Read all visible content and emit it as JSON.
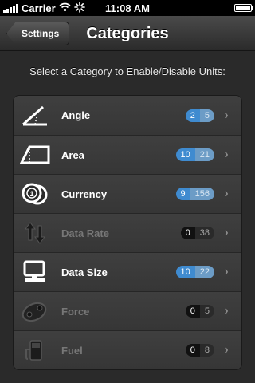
{
  "status_bar": {
    "carrier": "Carrier",
    "time": "11:08 AM"
  },
  "nav": {
    "back_label": "Settings",
    "title": "Categories"
  },
  "instruction": "Select a Category to Enable/Disable Units:",
  "categories": [
    {
      "label": "Angle",
      "enabled": "2",
      "total": "5",
      "state": "on"
    },
    {
      "label": "Area",
      "enabled": "10",
      "total": "21",
      "state": "on"
    },
    {
      "label": "Currency",
      "enabled": "9",
      "total": "156",
      "state": "on"
    },
    {
      "label": "Data Rate",
      "enabled": "0",
      "total": "38",
      "state": "off"
    },
    {
      "label": "Data Size",
      "enabled": "10",
      "total": "22",
      "state": "on"
    },
    {
      "label": "Force",
      "enabled": "0",
      "total": "5",
      "state": "off"
    },
    {
      "label": "Fuel",
      "enabled": "0",
      "total": "8",
      "state": "off"
    }
  ],
  "colors": {
    "accent": "#3f8bd0",
    "background": "#2a2a2a"
  }
}
